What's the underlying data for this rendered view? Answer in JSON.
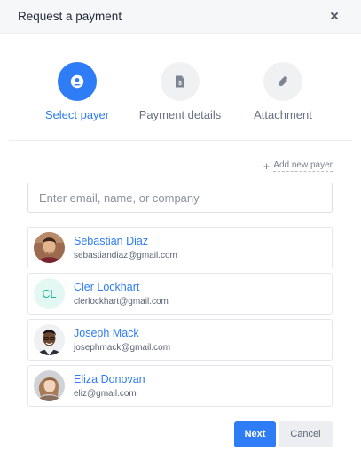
{
  "modal": {
    "title": "Request a payment",
    "close_icon": "close-icon"
  },
  "steps": [
    {
      "label": "Select payer",
      "icon": "user-circle-icon",
      "active": true
    },
    {
      "label": "Payment details",
      "icon": "document-dollar-icon",
      "active": false
    },
    {
      "label": "Attachment",
      "icon": "paperclip-icon",
      "active": false
    }
  ],
  "add_payer": {
    "label": "Add new payer",
    "icon": "plus-icon"
  },
  "search": {
    "placeholder": "Enter email, name, or company",
    "value": ""
  },
  "payers": [
    {
      "name": "Sebastian Diaz",
      "email": "sebastiandiaz@gmail.com",
      "avatar": "photo"
    },
    {
      "name": "Cler Lockhart",
      "email": "clerlockhart@gmail.com",
      "avatar": "initials",
      "initials": "CL"
    },
    {
      "name": "Joseph Mack",
      "email": "josephmack@gmail.com",
      "avatar": "photo"
    },
    {
      "name": "Eliza Donovan",
      "email": "eliz@gmail.com",
      "avatar": "photo"
    }
  ],
  "actions": {
    "next_label": "Next",
    "cancel_label": "Cancel"
  },
  "colors": {
    "accent": "#2e7cf6",
    "initials_bg": "#e3f7f3",
    "initials_text": "#1fb594",
    "cancel_bg": "#eceef1"
  }
}
